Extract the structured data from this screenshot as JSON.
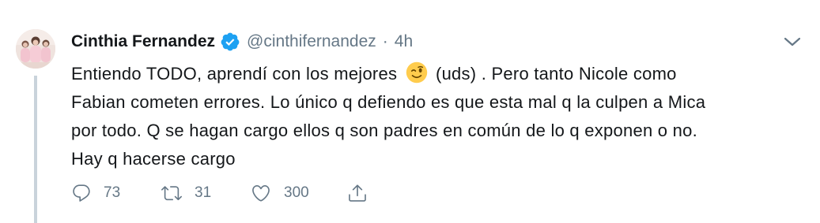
{
  "tweet": {
    "author": {
      "fullname": "Cinthia Fernandez",
      "username": "@cinthifernandez",
      "verified": true,
      "separator": "·",
      "time": "4h"
    },
    "text_lines": {
      "line1_before": "Entiendo TODO, aprendí con los mejores",
      "line1_after": "(uds) . Pero tanto Nicole como",
      "line2": "Fabian cometen errores. Lo único q defiendo es que esta mal q la culpen a Mica",
      "line3": "por todo. Q se hagan cargo ellos q son padres en común de lo q exponen o no.",
      "line4": "Hay q hacerse cargo"
    },
    "emoji": "winking-face",
    "actions": {
      "reply_count": "73",
      "retweet_count": "31",
      "like_count": "300"
    },
    "icons": [
      "avatar",
      "verified-badge-icon",
      "chevron-down-icon",
      "reply-icon",
      "retweet-icon",
      "heart-icon",
      "share-icon"
    ],
    "colors": {
      "verified": "#1da1f2",
      "secondary_text": "#657786",
      "primary_text": "#14171a",
      "thread_line": "#c9d3db"
    }
  }
}
